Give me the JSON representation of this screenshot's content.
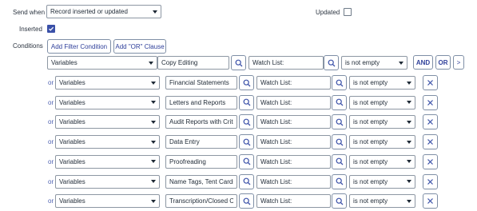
{
  "form": {
    "send_when_label": "Send when",
    "send_when_value": "Record inserted or updated",
    "updated_label": "Updated",
    "inserted_label": "Inserted",
    "inserted_checked": true,
    "updated_checked": false,
    "conditions_label": "Conditions",
    "add_filter_label": "Add Filter Condition",
    "add_or_label": "Add \"OR\" Clause",
    "and_label": "AND",
    "or_btn_label": "OR",
    "more_label": ">"
  },
  "conditions": [
    {
      "prefix": "",
      "field": "Variables",
      "variable": "Copy Editing",
      "sub": "Watch List:",
      "operator": "is not empty"
    },
    {
      "prefix": "or",
      "field": "Variables",
      "variable": "Financial Statements",
      "sub": "Watch List:",
      "operator": "is not empty"
    },
    {
      "prefix": "or",
      "field": "Variables",
      "variable": "Letters and Reports",
      "sub": "Watch List:",
      "operator": "is not empty"
    },
    {
      "prefix": "or",
      "field": "Variables",
      "variable": "Audit Reports with Critic",
      "sub": "Watch List:",
      "operator": "is not empty"
    },
    {
      "prefix": "or",
      "field": "Variables",
      "variable": "Data Entry",
      "sub": "Watch List:",
      "operator": "is not empty"
    },
    {
      "prefix": "or",
      "field": "Variables",
      "variable": "Proofreading",
      "sub": "Watch List:",
      "operator": "is not empty"
    },
    {
      "prefix": "or",
      "field": "Variables",
      "variable": "Name Tags, Tent Cards ar",
      "sub": "Watch List:",
      "operator": "is not empty"
    },
    {
      "prefix": "or",
      "field": "Variables",
      "variable": "Transcription/Closed Car",
      "sub": "Watch List:",
      "operator": "is not empty"
    }
  ],
  "icons": {
    "search": "search-icon",
    "remove": "close-icon",
    "dropdown": "chevron-down-icon",
    "checkbox_checked": "check-icon"
  },
  "colors": {
    "accent": "#3a50a8",
    "link": "#4b5fb0"
  }
}
